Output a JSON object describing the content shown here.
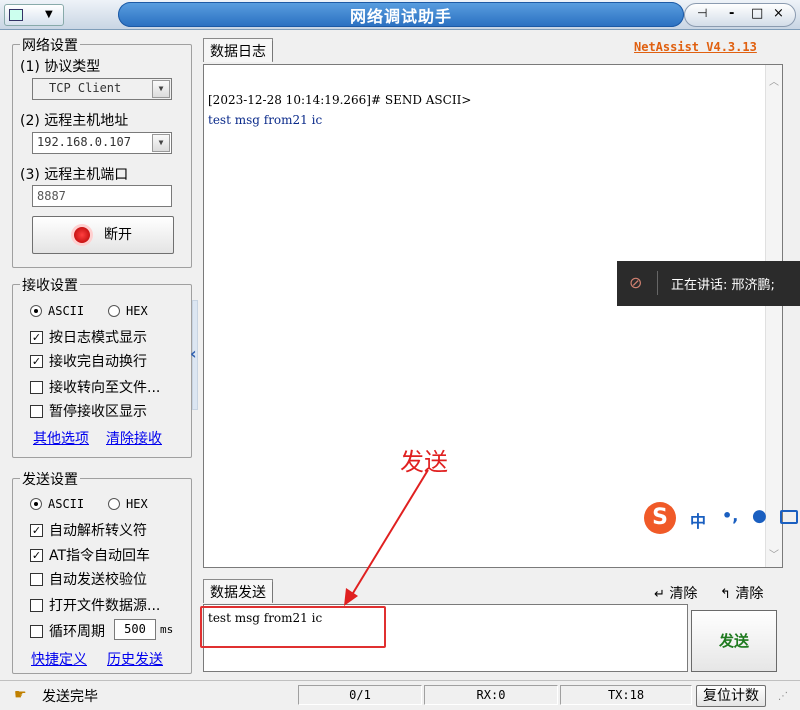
{
  "window": {
    "title": "网络调试助手",
    "version": "NetAssist V4.3.13",
    "min": "-",
    "max": "□",
    "close": "×",
    "pin": "⊣"
  },
  "network": {
    "legend": "网络设置",
    "protocol_label": "(1) 协议类型",
    "protocol_value": "TCP Client",
    "host_label": "(2) 远程主机地址",
    "host_value": "192.168.0.107",
    "port_label": "(3) 远程主机端口",
    "port_value": "8887",
    "disconnect_label": "断开"
  },
  "receive": {
    "legend": "接收设置",
    "ascii": "ASCII",
    "hex": "HEX",
    "selected_mode": "ASCII",
    "options": [
      {
        "label": "按日志模式显示",
        "checked": true
      },
      {
        "label": "接收完自动换行",
        "checked": true
      },
      {
        "label": "接收转向至文件...",
        "checked": false
      },
      {
        "label": "暂停接收区显示",
        "checked": false
      }
    ],
    "other_options": "其他选项",
    "clear_receive": "清除接收"
  },
  "send": {
    "legend": "发送设置",
    "ascii": "ASCII",
    "hex": "HEX",
    "selected_mode": "ASCII",
    "options": [
      {
        "label": "自动解析转义符",
        "checked": true
      },
      {
        "label": "AT指令自动回车",
        "checked": true
      },
      {
        "label": "自动发送校验位",
        "checked": false
      },
      {
        "label": "打开文件数据源...",
        "checked": false
      }
    ],
    "loop_label": "循环周期",
    "loop_value": "500",
    "loop_unit": "ms",
    "loop_checked": false,
    "shortcut": "快捷定义",
    "history": "历史发送"
  },
  "log": {
    "tab": "数据日志",
    "lines": [
      "[2023-12-28 10:14:19.266]# SEND ASCII>",
      "test msg from21 ic"
    ]
  },
  "send_panel": {
    "tab": "数据发送",
    "clear1": "清除",
    "clear2": "清除",
    "text": "test msg from21 ic",
    "send_button": "发送"
  },
  "status": {
    "message": "发送完毕",
    "page": "0/1",
    "rx": "RX:0",
    "tx": "TX:18",
    "reset": "复位计数"
  },
  "overlay": {
    "speaking": "正在讲话: 邢济鹏;",
    "annotation": "发送",
    "ime_zh": "中",
    "ime_punct": "•,",
    "colors": {
      "annotation": "#e02020",
      "send_text": "#1f7a1f",
      "version": "#e06010"
    }
  }
}
